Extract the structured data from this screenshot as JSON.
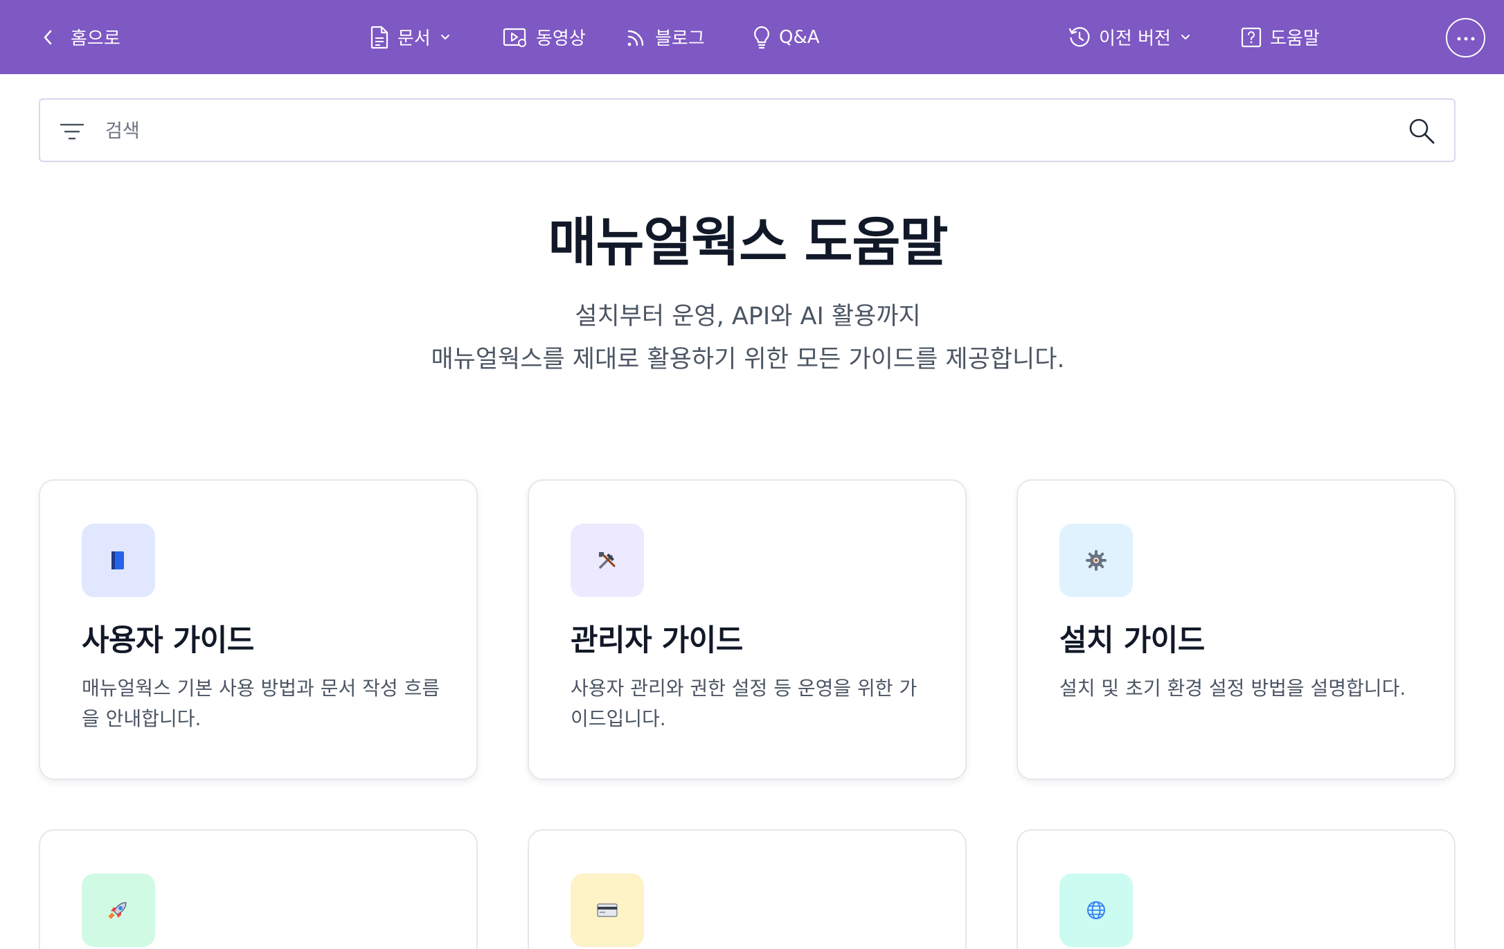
{
  "nav": {
    "home": "홈으로",
    "docs": "문서",
    "video": "동영상",
    "blog": "블로그",
    "qna": "Q&A",
    "prev_version": "이전 버전",
    "help": "도움말"
  },
  "search": {
    "placeholder": "검색"
  },
  "hero": {
    "title": "매뉴얼웍스 도움말",
    "subtitle_line1": "설치부터 운영, API와 AI 활용까지",
    "subtitle_line2": "매뉴얼웍스를 제대로 활용하기 위한 모든 가이드를 제공합니다."
  },
  "cards": [
    {
      "icon": "book-icon",
      "title": "사용자 가이드",
      "description": "매뉴얼웍스 기본 사용 방법과 문서 작성 흐름을 안내합니다."
    },
    {
      "icon": "tools-icon",
      "title": "관리자 가이드",
      "description": "사용자 관리와 권한 설정 등 운영을 위한 가이드입니다."
    },
    {
      "icon": "gear-icon",
      "title": "설치 가이드",
      "description": "설치 및 초기 환경 설정 방법을 설명합니다."
    },
    {
      "icon": "rocket-icon"
    },
    {
      "icon": "credit-card-icon"
    },
    {
      "icon": "globe-icon"
    }
  ],
  "colors": {
    "brand": "#7e58c3",
    "badge_blue": "#e0e7ff",
    "badge_purple": "#ede9fe",
    "badge_sky": "#e0f2fe",
    "badge_green": "#d1fae5",
    "badge_yellow": "#fef3c7",
    "badge_teal": "#ccfbf1"
  }
}
